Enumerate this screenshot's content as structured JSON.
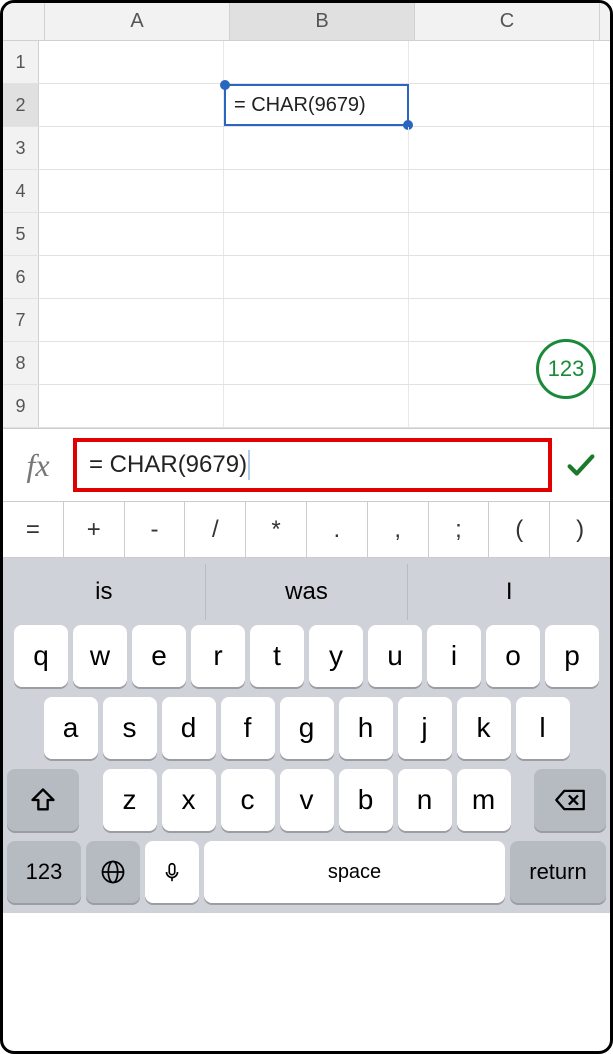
{
  "columns": [
    "A",
    "B",
    "C"
  ],
  "active_column_index": 1,
  "rows": [
    1,
    2,
    3,
    4,
    5,
    6,
    7,
    8,
    9
  ],
  "active_row_index": 1,
  "selected_cell": {
    "row": 2,
    "col": "B",
    "display": "= CHAR(9679)"
  },
  "fab_label": "123",
  "formula_bar": {
    "fx": "fx",
    "value": "= CHAR(9679)"
  },
  "operators": [
    "=",
    "+",
    "-",
    "/",
    "*",
    ".",
    ",",
    ";",
    "(",
    ")"
  ],
  "keyboard": {
    "suggestions": [
      "is",
      "was",
      "I"
    ],
    "row1": [
      "q",
      "w",
      "e",
      "r",
      "t",
      "y",
      "u",
      "i",
      "o",
      "p"
    ],
    "row2": [
      "a",
      "s",
      "d",
      "f",
      "g",
      "h",
      "j",
      "k",
      "l"
    ],
    "row3": [
      "z",
      "x",
      "c",
      "v",
      "b",
      "n",
      "m"
    ],
    "num_key": "123",
    "space_label": "space",
    "return_label": "return"
  }
}
